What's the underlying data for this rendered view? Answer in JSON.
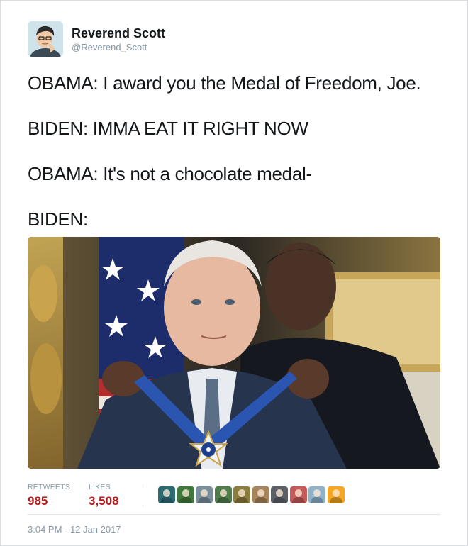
{
  "author": {
    "display_name": "Reverend Scott",
    "handle": "@Reverend_Scott"
  },
  "tweet": {
    "lines": [
      "OBAMA: I award you the Medal of Freedom, Joe.",
      "BIDEN: IMMA EAT IT RIGHT NOW",
      "OBAMA: It's not a chocolate medal-",
      "BIDEN:"
    ]
  },
  "stats": {
    "retweets_label": "RETWEETS",
    "retweets_count": "985",
    "likes_label": "LIKES",
    "likes_count": "3,508"
  },
  "likers": [
    {
      "color": "#2d6b73"
    },
    {
      "color": "#3f7a3c"
    },
    {
      "color": "#7a8f9c"
    },
    {
      "color": "#4f7c4a"
    },
    {
      "color": "#8c7c3d"
    },
    {
      "color": "#a8845a"
    },
    {
      "color": "#5b5f66"
    },
    {
      "color": "#c45a5a"
    },
    {
      "color": "#8fb2c8"
    },
    {
      "color": "#f5a623"
    }
  ],
  "timestamp": "3:04 PM - 12 Jan 2017"
}
